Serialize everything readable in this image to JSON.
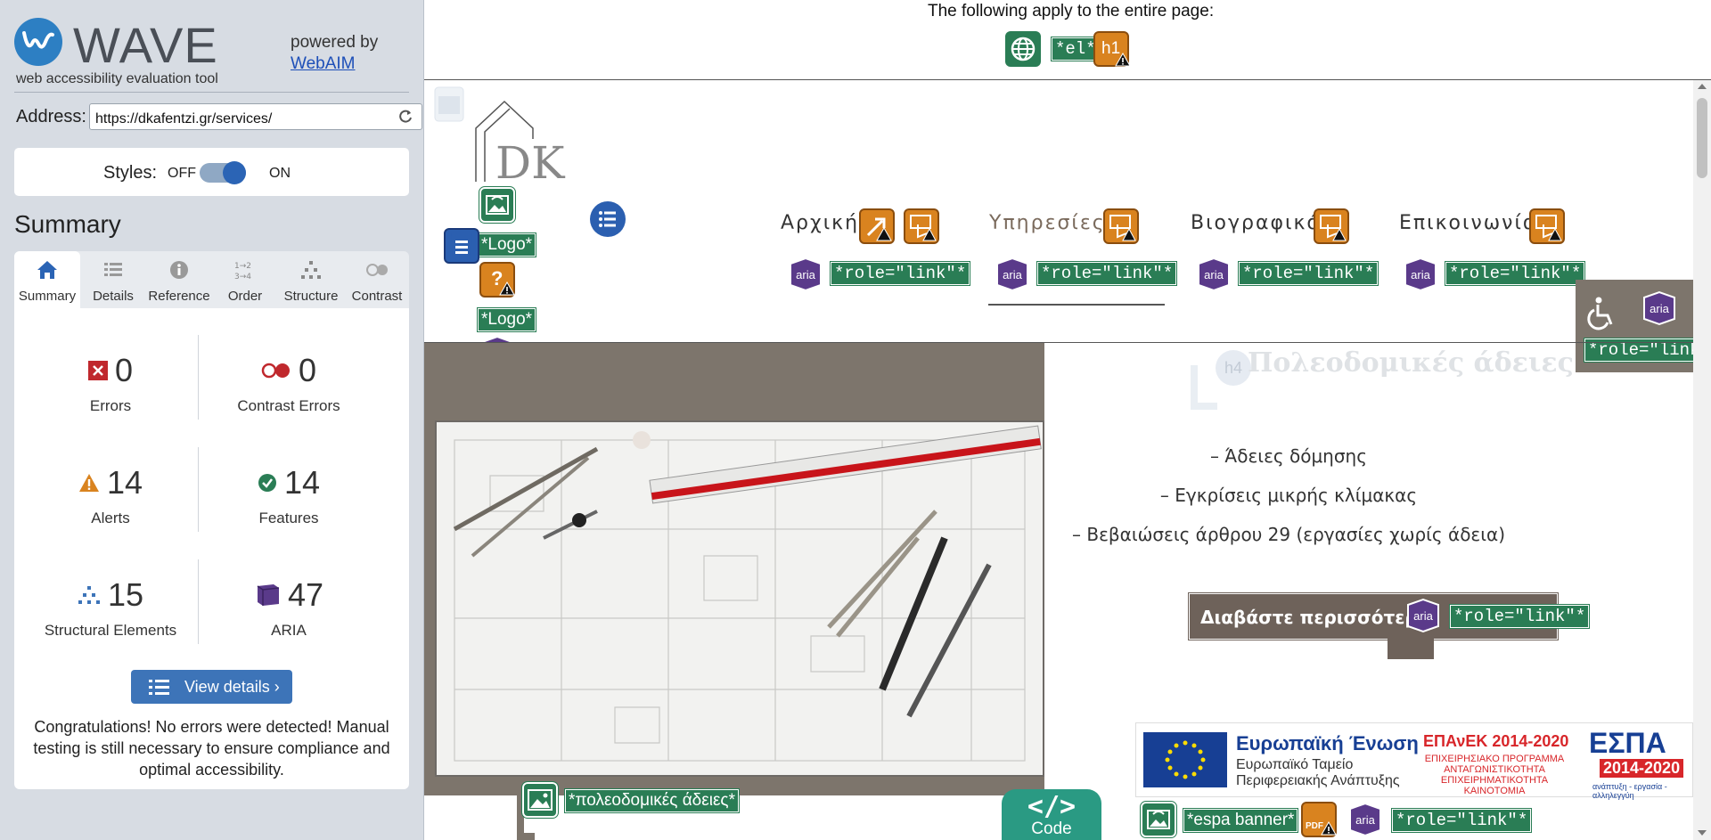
{
  "wave": {
    "title": "WAVE",
    "tagline": "web accessibility evaluation tool",
    "powered_by": "powered by",
    "webaim": "WebAIM",
    "address_label": "Address:",
    "address_value": "https://dkafentzi.gr/services/",
    "styles_label": "Styles:",
    "styles_off": "OFF",
    "styles_on": "ON",
    "summary_heading": "Summary",
    "tabs": [
      {
        "label": "Summary"
      },
      {
        "label": "Details"
      },
      {
        "label": "Reference"
      },
      {
        "label": "Order"
      },
      {
        "label": "Structure"
      },
      {
        "label": "Contrast"
      }
    ],
    "stats": {
      "errors": {
        "value": "0",
        "label": "Errors"
      },
      "contrast": {
        "value": "0",
        "label": "Contrast Errors"
      },
      "alerts": {
        "value": "14",
        "label": "Alerts"
      },
      "features": {
        "value": "14",
        "label": "Features"
      },
      "structural": {
        "value": "15",
        "label": "Structural Elements"
      },
      "aria": {
        "value": "47",
        "label": "ARIA"
      }
    },
    "view_details": "View details ›",
    "congrats": "Congratulations! No errors were detected! Manual testing is still necessary to ensure compliance and optimal accessibility."
  },
  "page": {
    "header_text": "The following apply to the entire page:",
    "lang_label": "*el*",
    "h1_label": "h1",
    "logo_label": "*Logo*",
    "logo_label_2": "*Logo*",
    "aria_text": "aria",
    "role_link": "*role=\"link\"*",
    "nav": [
      {
        "label": "Αρχική"
      },
      {
        "label": "Υπηρεσίες"
      },
      {
        "label": "Βιογραφικό"
      },
      {
        "label": "Επικοινωνία"
      }
    ],
    "faded_heading": "Πολεοδομικές άδειες",
    "faded_h4": "h4",
    "services": [
      "– Άδειες δόμησης",
      "– Εγκρίσεις μικρής κλίμακας",
      "– Βεβαιώσεις άρθρου 29 (εργασίες χωρίς άδεια)"
    ],
    "read_more": "Διαβάστε περισσότερ",
    "image_alt": "*πολεοδομικές άδειες*",
    "espa_alt": "*espa banner*",
    "pdf_label": "PDF",
    "code_glyph": "</>",
    "code_label": "Code",
    "espa": {
      "eu_title": "Ευρωπαϊκή Ένωση",
      "eu_sub1": "Ευρωπαϊκό Ταμείο",
      "eu_sub2": "Περιφερειακής Ανάπτυξης",
      "epanek": "ΕΠΑνΕΚ 2014-2020",
      "epanek_sub1": "ΕΠΙΧΕΙΡΗΣΙΑΚΟ ΠΡΟΓΡΑΜΜΑ",
      "epanek_sub2": "ΑΝΤΑΓΩΝΙΣΤΙΚΟΤΗΤΑ",
      "epanek_sub3": "ΕΠΙΧΕΙΡΗΜΑΤΙΚΟΤΗΤΑ",
      "epanek_sub4": "ΚΑΙΝΟΤΟΜΙΑ",
      "espa_word": "ΕΣΠΑ",
      "espa_years": "2014-2020",
      "espa_tag": "ανάπτυξη - εργασία - αλληλεγγύη"
    }
  },
  "colors": {
    "wave_blue": "#2d7fc3",
    "feature_green": "#2a7d55",
    "alert_orange": "#d9831f",
    "aria_purple": "#5a3a8a",
    "error_red": "#c0282d"
  }
}
